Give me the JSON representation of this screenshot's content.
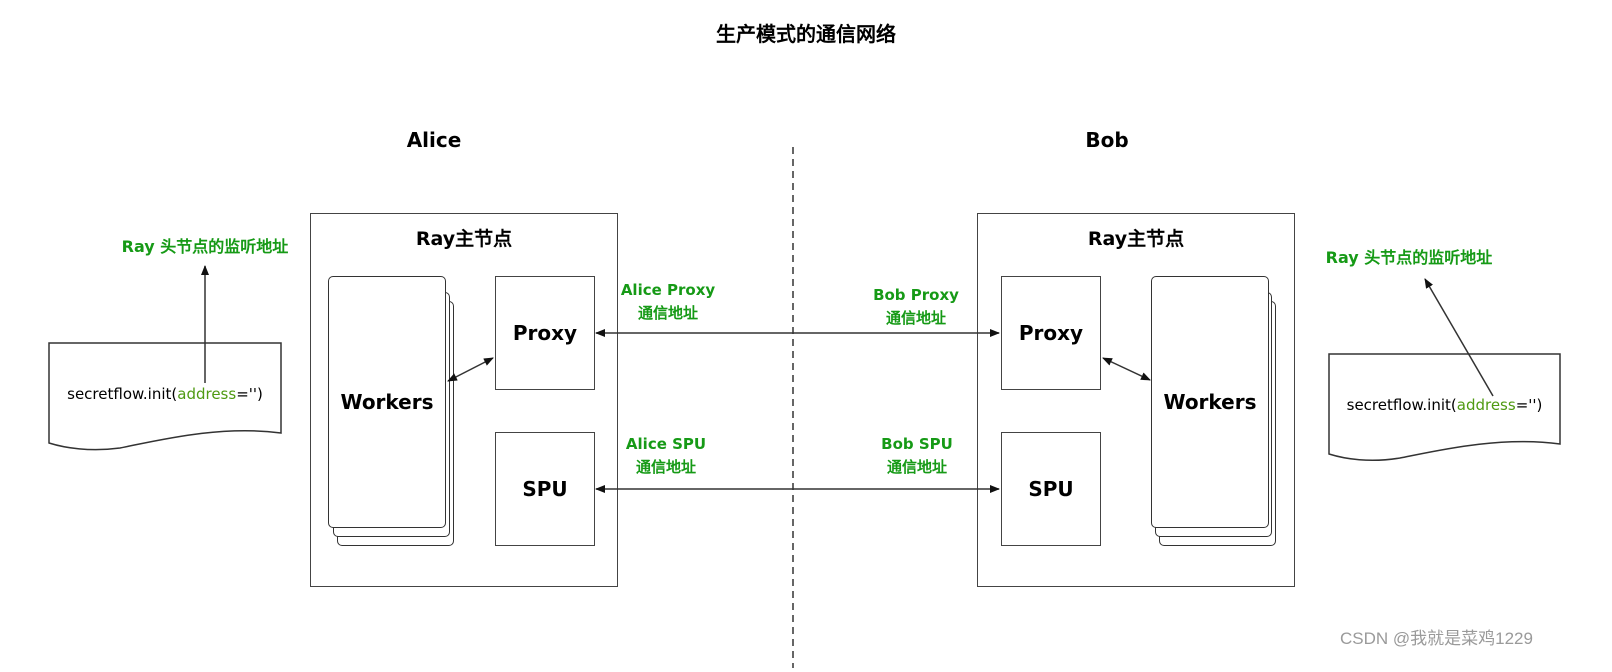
{
  "title": "生产模式的通信网络",
  "parties": [
    {
      "name": "Alice",
      "node_title": "Ray主节点",
      "workers_label": "Workers",
      "proxy_label": "Proxy",
      "spu_label": "SPU",
      "head_listen_label": "Ray 头节点的监听地址",
      "code": {
        "prefix": "secretflow.init(",
        "keyword": "address",
        "suffix": "='')"
      },
      "proxy_address_label": [
        "Alice Proxy",
        "通信地址"
      ],
      "spu_address_label": [
        "Alice SPU",
        "通信地址"
      ]
    },
    {
      "name": "Bob",
      "node_title": "Ray主节点",
      "workers_label": "Workers",
      "proxy_label": "Proxy",
      "spu_label": "SPU",
      "head_listen_label": "Ray 头节点的监听地址",
      "code": {
        "prefix": "secretflow.init(",
        "keyword": "address",
        "suffix": "='')"
      },
      "proxy_address_label": [
        "Bob Proxy",
        "通信地址"
      ],
      "spu_address_label": [
        "Bob SPU",
        "通信地址"
      ]
    }
  ],
  "connections": [
    {
      "from": "Alice Proxy",
      "to": "Bob Proxy",
      "direction": "bidirectional"
    },
    {
      "from": "Alice SPU",
      "to": "Bob SPU",
      "direction": "bidirectional"
    },
    {
      "from": "Alice Workers",
      "to": "Alice Proxy",
      "direction": "bidirectional"
    },
    {
      "from": "Bob Proxy",
      "to": "Bob Workers",
      "direction": "bidirectional"
    }
  ],
  "colors": {
    "label_green": "#169a16",
    "keyword_green": "#4f9a12",
    "line": "#333333"
  },
  "watermark": "CSDN @我就是菜鸡1229"
}
